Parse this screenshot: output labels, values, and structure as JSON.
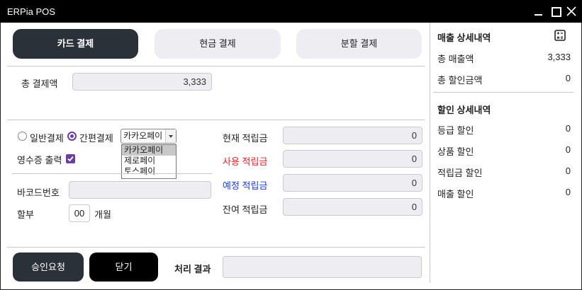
{
  "window": {
    "title": "ERPia POS"
  },
  "tabs": {
    "card": "카드 결제",
    "cash": "현금 결제",
    "split": "분할 결제"
  },
  "total": {
    "label": "총 결제액",
    "value": "3,333"
  },
  "payment": {
    "general_label": "일반결제",
    "easy_label": "간편결제",
    "easy_selected": "카카오페이",
    "options": [
      "카카오페이",
      "제로페이",
      "토스페이"
    ],
    "receipt_label": "영수증 출력"
  },
  "barcode": {
    "label": "바코드번호",
    "value": ""
  },
  "installment": {
    "label": "할부",
    "value": "00",
    "unit": "개월"
  },
  "points": {
    "current_label": "현재 적립금",
    "current_value": "0",
    "use_label": "사용 적립금",
    "use_value": "0",
    "expected_label": "예정 적립금",
    "expected_value": "0",
    "remaining_label": "잔여 적립금",
    "remaining_value": "0"
  },
  "buttons": {
    "approve": "승인요청",
    "close": "닫기"
  },
  "result": {
    "label": "처리 결과",
    "value": ""
  },
  "sales_detail": {
    "title": "매출 상세내역",
    "icon": "calculator-icon",
    "total_sales_label": "총 매출액",
    "total_sales_value": "3,333",
    "total_discount_label": "총 할인금액",
    "total_discount_value": "0"
  },
  "discount_detail": {
    "title": "할인 상세내역",
    "grade_label": "등급 할인",
    "grade_value": "0",
    "product_label": "상품 할인",
    "product_value": "0",
    "points_label": "적립금 할인",
    "points_value": "0",
    "sales_label": "매출 할인",
    "sales_value": "0"
  },
  "colors": {
    "accent": "#6b3fa0",
    "dark_button": "#2b3138",
    "use_points": "#d8232a",
    "expected_points": "#1a3ecf"
  }
}
